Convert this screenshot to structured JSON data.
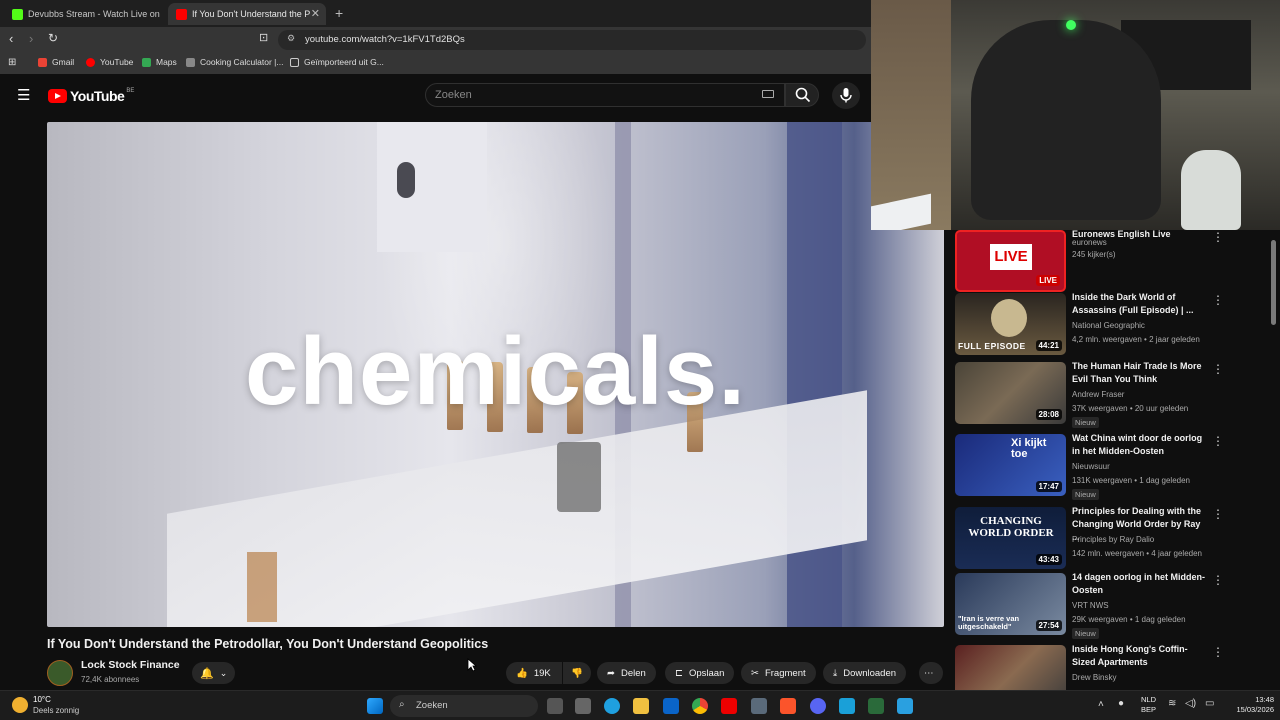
{
  "browser": {
    "tabs": [
      {
        "title": "Devubbs Stream - Watch Live on",
        "color": "#53fc18"
      },
      {
        "title": "If You Don't Understand the P",
        "color": "#ff0000",
        "active": true
      }
    ],
    "url": "youtube.com/watch?v=1kFV1Td2BQs",
    "bookmarks": [
      "Gmail",
      "YouTube",
      "Maps",
      "Cooking Calculator |...",
      "Geïmporteerd uit G..."
    ]
  },
  "youtube": {
    "logo_text": "YouTube",
    "country_code": "BE",
    "search_placeholder": "Zoeken"
  },
  "video": {
    "caption": "chemicals.",
    "title": "If You Don't Understand the Petrodollar, You Don't Understand Geopolitics",
    "channel": "Lock Stock Finance",
    "subscribers": "72,4K abonnees",
    "likes": "19K",
    "actions": {
      "share": "Delen",
      "save": "Opslaan",
      "clip": "Fragment",
      "download": "Downloaden"
    }
  },
  "recommendations": [
    {
      "title": "Euronews English Live",
      "channel": "euronews",
      "meta": "245 kijker(s)",
      "badge": "",
      "duration": "LIVE",
      "thumb_color": "#c0102a"
    },
    {
      "title": "Inside the Dark World of Assassins (Full Episode) | ...",
      "channel": "National Geographic",
      "meta": "4,2 mln. weergaven • 2 jaar geleden",
      "badge": "",
      "duration": "44:21",
      "thumb_label": "FULL EPISODE",
      "thumb_color": "#3a3328"
    },
    {
      "title": "The Human Hair Trade Is More Evil Than You Think",
      "channel": "Andrew Fraser",
      "meta": "37K weergaven • 20 uur geleden",
      "badge": "Nieuw",
      "duration": "28:08",
      "thumb_color": "#5a5448"
    },
    {
      "title": "Wat China wint door de oorlog in het Midden-Oosten",
      "channel": "Nieuwsuur",
      "meta": "131K weergaven • 1 dag geleden",
      "badge": "Nieuw",
      "duration": "17:47",
      "thumb_label": "Xi kijkt toe",
      "thumb_color": "#1e2a6a"
    },
    {
      "title": "Principles for Dealing with the Changing World Order by Ray ...",
      "channel": "Principles by Ray Dalio",
      "meta": "142 mln. weergaven • 4 jaar geleden",
      "badge": "",
      "duration": "43:43",
      "thumb_label": "CHANGING WORLD ORDER",
      "thumb_color": "#0f1d3a"
    },
    {
      "title": "14 dagen oorlog in het Midden-Oosten",
      "channel": "VRT NWS",
      "meta": "29K weergaven • 1 dag geleden",
      "badge": "Nieuw",
      "duration": "27:54",
      "thumb_label": "\"Iran is verre van uitgeschakeld\"",
      "thumb_color": "#3a4a6a"
    },
    {
      "title": "Inside Hong Kong's Coffin-Sized Apartments",
      "channel": "Drew Binsky",
      "meta": "",
      "badge": "",
      "duration": "",
      "thumb_color": "#6a2a2a"
    }
  ],
  "taskbar": {
    "weather_temp": "10°C",
    "weather_desc": "Deels zonnig",
    "search_label": "Zoeken",
    "lang_top": "NLD",
    "lang_bottom": "BEP",
    "time": "13:48",
    "date": "15/03/2026"
  }
}
